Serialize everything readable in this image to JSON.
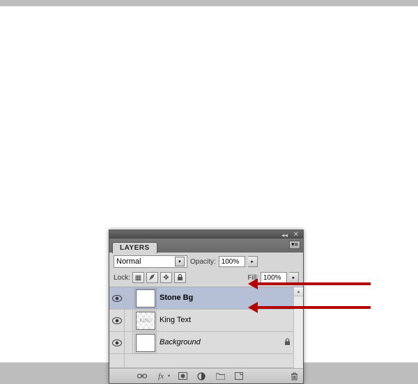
{
  "panel": {
    "title": "LAYERS"
  },
  "blend": {
    "value": "Normal"
  },
  "opacity": {
    "label": "Opacity:",
    "value": "100%"
  },
  "lock": {
    "label": "Lock:"
  },
  "fill": {
    "label": "Fill:",
    "value": "100%"
  },
  "layers": [
    {
      "name": "Stone Bg",
      "bold": true,
      "italic": false,
      "selected": true,
      "locked": false,
      "thumb": "white"
    },
    {
      "name": "King Text",
      "bold": false,
      "italic": false,
      "selected": false,
      "locked": false,
      "thumb": "king"
    },
    {
      "name": "Background",
      "bold": false,
      "italic": true,
      "selected": false,
      "locked": true,
      "thumb": "white"
    }
  ]
}
